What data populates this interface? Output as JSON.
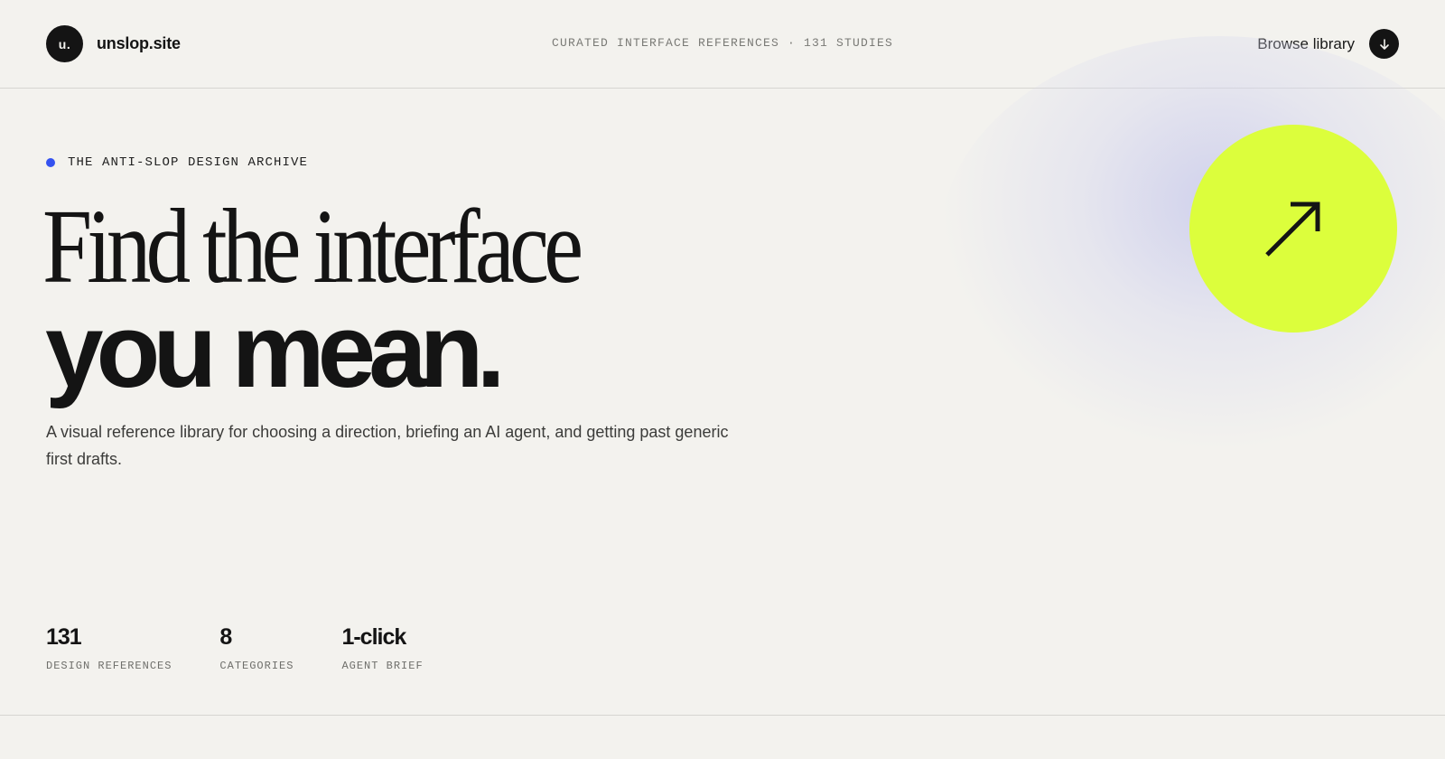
{
  "header": {
    "logo_mark": "u.",
    "site_name": "unslop.site",
    "meta": "CURATED INTERFACE REFERENCES · 131 STUDIES",
    "browse_label": "Browse library",
    "browse_icon": "arrow-down-icon"
  },
  "hero": {
    "eyebrow": "THE ANTI-SLOP DESIGN ARCHIVE",
    "headline_line1": "Find the interface",
    "headline_line2": "you mean.",
    "subcopy": "A visual reference library for choosing a direction, briefing an AI agent, and getting past generic first drafts.",
    "cta_icon": "arrow-up-right-icon"
  },
  "stats": [
    {
      "value": "131",
      "label": "DESIGN REFERENCES"
    },
    {
      "value": "8",
      "label": "CATEGORIES"
    },
    {
      "value": "1-click",
      "label": "AGENT BRIEF"
    }
  ],
  "colors": {
    "background": "#f3f2ee",
    "ink": "#141414",
    "accent_lime": "#dcfe3c",
    "accent_blue": "#3452f0",
    "glow": "#c4c6ec"
  }
}
